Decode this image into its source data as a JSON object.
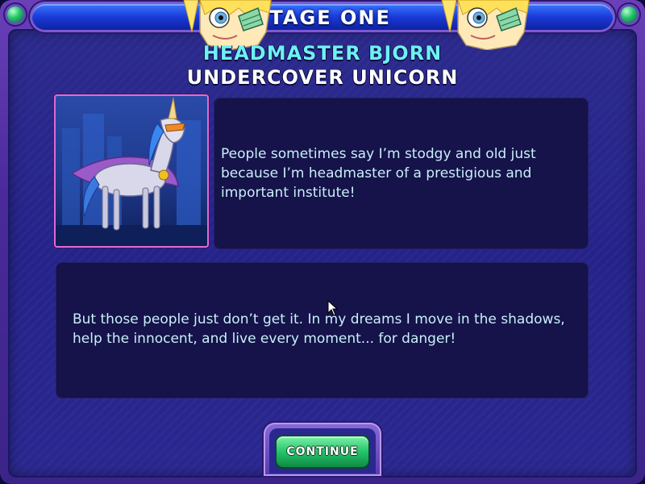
{
  "header": {
    "stage_title": "STAGE ONE"
  },
  "character": {
    "name": "HEADMASTER BJORN",
    "title": "UNDERCOVER UNICORN",
    "portrait_icon": "unicorn-portrait"
  },
  "dialog": {
    "line_1": "People sometimes say I’m stodgy and old just because I’m headmaster of a prestigious and important institute!",
    "line_2": "But those people just don’t get it. In my dreams I move in the shadows, help the innocent, and live every moment... for danger!"
  },
  "buttons": {
    "continue_label": "CONTINUE"
  },
  "colors": {
    "frame": "#4a2a9a",
    "background": "#2b2a8c",
    "panel": "#16124a",
    "name_cyan": "#6ef0f4",
    "dialog_text": "#c8f0f8",
    "continue_green": "#24c46a"
  }
}
